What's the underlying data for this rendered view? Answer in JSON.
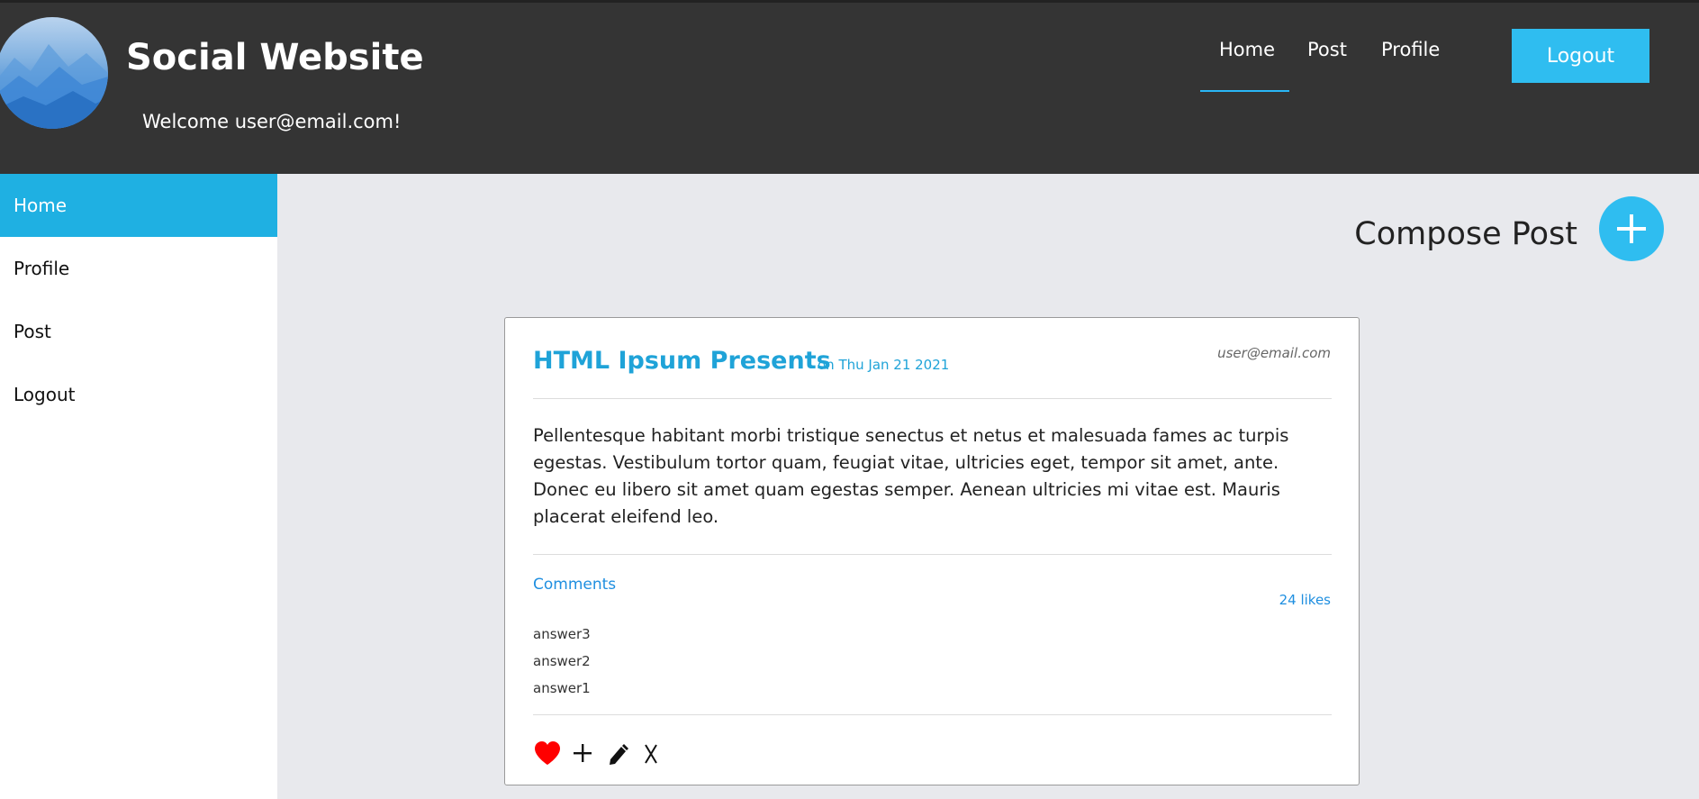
{
  "header": {
    "site_title": "Social Website",
    "welcome_text": "Welcome user@email.com!",
    "nav": [
      {
        "label": "Home",
        "active": true
      },
      {
        "label": "Post"
      },
      {
        "label": "Profile"
      }
    ],
    "logout_label": "Logout"
  },
  "sidebar": {
    "items": [
      {
        "label": "Home",
        "active": true
      },
      {
        "label": "Profile"
      },
      {
        "label": "Post"
      },
      {
        "label": "Logout"
      }
    ]
  },
  "compose": {
    "label": "Compose Post",
    "icon": "plus-icon"
  },
  "post": {
    "title": "HTML Ipsum Presents",
    "date": "on Thu Jan 21 2021",
    "author": "user@email.com",
    "body": "Pellentesque habitant morbi tristique senectus et netus et malesuada fames ac turpis egestas. Vestibulum tortor quam, feugiat vitae, ultricies eget, tempor sit amet, ante. Donec eu libero sit amet quam egestas semper. Aenean ultricies mi vitae est. Mauris placerat eleifend leo.",
    "comments_label": "Comments",
    "likes": "24 likes",
    "comments": [
      "answer3",
      "answer2",
      "answer1"
    ],
    "actions": {
      "like": {
        "icon": "heart-icon",
        "label": ""
      },
      "add": {
        "icon": "plus-icon",
        "label": "+"
      },
      "edit": {
        "icon": "pencil-icon",
        "label": ""
      },
      "delete": {
        "icon": "close-icon",
        "label": "X"
      }
    }
  },
  "colors": {
    "accent": "#2fbdf0",
    "header_bg": "#343434",
    "link": "#1fa3d8",
    "heart": "#ff0000"
  }
}
